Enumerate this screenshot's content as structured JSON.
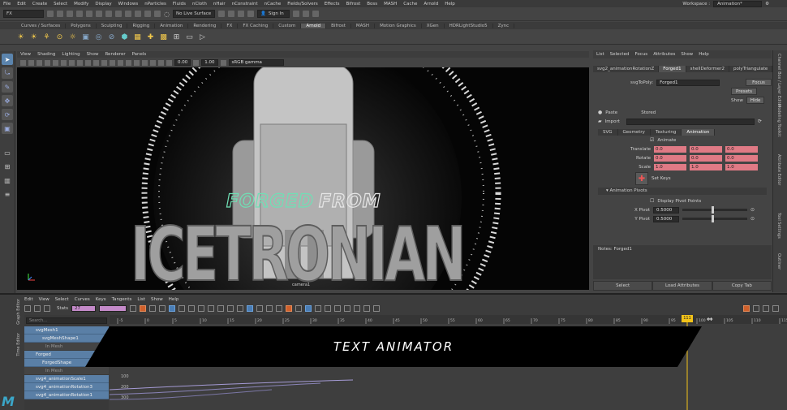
{
  "menubar": {
    "items": [
      "File",
      "Edit",
      "Create",
      "Select",
      "Modify",
      "Display",
      "Windows",
      "nParticles",
      "Fluids",
      "nCloth",
      "nHair",
      "nConstraint",
      "nCache",
      "Fields/Solvers",
      "Effects",
      "Bifrost",
      "Boss",
      "MASH",
      "Cache",
      "Arnold",
      "Help"
    ],
    "workspace_label": "Workspace :",
    "workspace_value": "Animation*"
  },
  "statusline": {
    "mode": "FX",
    "live_surface": "No Live Surface",
    "sign_in": "Sign In"
  },
  "shelf_tabs": [
    "Curves / Surfaces",
    "Polygons",
    "Sculpting",
    "Rigging",
    "Animation",
    "Rendering",
    "FX",
    "FX Caching",
    "Custom",
    "Arnold",
    "Bifrost",
    "MASH",
    "Motion Graphics",
    "XGen",
    "HDRLightStudio5",
    "Zync"
  ],
  "shelf_active_tab": "Arnold",
  "viewport": {
    "menu": [
      "View",
      "Shading",
      "Lighting",
      "Show",
      "Renderer",
      "Panels"
    ],
    "near_value": "0.00",
    "far_value": "1.00",
    "color_space": "sRGB gamma",
    "camera_label": "camera1",
    "scene_text_small_1": "FORGED",
    "scene_text_small_2": "FROM",
    "scene_text_big": "ICETRONIAN"
  },
  "attribute_editor": {
    "menu": [
      "List",
      "Selected",
      "Focus",
      "Attributes",
      "Show",
      "Help"
    ],
    "tabs": [
      "svg2_animationRotationZ",
      "Forged1",
      "shellDeformer2",
      "polyTriangulate"
    ],
    "active_tab": "Forged1",
    "node_label": "svgToPoly:",
    "node_value": "Forged1",
    "focus_button": "Focus",
    "presets_button": "Presets",
    "show_button": "Show",
    "hide_button": "Hide",
    "paste_label": "Paste",
    "stored_label": "Stored",
    "import_label": "Import",
    "sub_tabs": [
      "SVG",
      "Geometry",
      "Texturing",
      "Animation"
    ],
    "active_sub_tab": "Animation",
    "animate_label": "Animate",
    "translate_label": "Translate",
    "translate_values": [
      "0.0",
      "0.0",
      "0.0"
    ],
    "rotate_label": "Rotate",
    "rotate_values": [
      "0.0",
      "0.0",
      "0.0"
    ],
    "scale_label": "Scale",
    "scale_values": [
      "1.0",
      "1.0",
      "1.0"
    ],
    "set_keys_label": "Set Keys",
    "pivots_section": "Animation Pivots",
    "display_pivot_label": "Display Pivot Points",
    "xpivot_label": "X Pivot",
    "xpivot_value": "0.5000",
    "ypivot_label": "Y Pivot",
    "ypivot_value": "0.5000",
    "notes_label": "Notes: Forged1",
    "bottom_buttons": [
      "Select",
      "Load Attributes",
      "Copy Tab"
    ]
  },
  "vertical_tabs": [
    "Channel Box / Layer Editor",
    "Modeling Toolkit",
    "Attribute Editor",
    "Tool Settings",
    "Outliner"
  ],
  "graph_editor": {
    "menu": [
      "Edit",
      "View",
      "Select",
      "Curves",
      "Keys",
      "Tangents",
      "List",
      "Show",
      "Help"
    ],
    "stats_label": "Stats",
    "stats_value_1": "27",
    "stats_value_2": "",
    "search_placeholder": "Search...",
    "outliner": [
      {
        "label": "svgMesh1",
        "kind": "main"
      },
      {
        "label": "svgMeshShape1",
        "kind": "sub"
      },
      {
        "label": "In Mesh",
        "kind": "gray"
      },
      {
        "label": "Forged",
        "kind": "main"
      },
      {
        "label": "ForgedShape",
        "kind": "sub"
      },
      {
        "label": "In Mesh",
        "kind": "gray"
      },
      {
        "label": "svg4_animationScale1",
        "kind": "main"
      },
      {
        "label": "svg4_animationRotation3",
        "kind": "main"
      },
      {
        "label": "svg4_animationRotation1",
        "kind": "main"
      }
    ],
    "ruler_ticks": [
      "-5",
      "0",
      "5",
      "10",
      "15",
      "20",
      "25",
      "30",
      "35",
      "40",
      "45",
      "50",
      "55",
      "60",
      "65",
      "70",
      "75",
      "80",
      "85",
      "90",
      "95",
      "100",
      "105",
      "110",
      "115",
      "120"
    ],
    "current_frame": "111",
    "value_labels": [
      "100",
      "200",
      "300"
    ],
    "side_label_1": "Graph Editor",
    "side_label_2": "Time Editor"
  },
  "banner": {
    "text": "TEXT ANIMATOR"
  },
  "logo": "M",
  "colors": {
    "accent_blue": "#5b84ad",
    "attr_pink": "#e07a85",
    "text_green": "#6fe0b5",
    "frame_marker": "#f3c319"
  }
}
